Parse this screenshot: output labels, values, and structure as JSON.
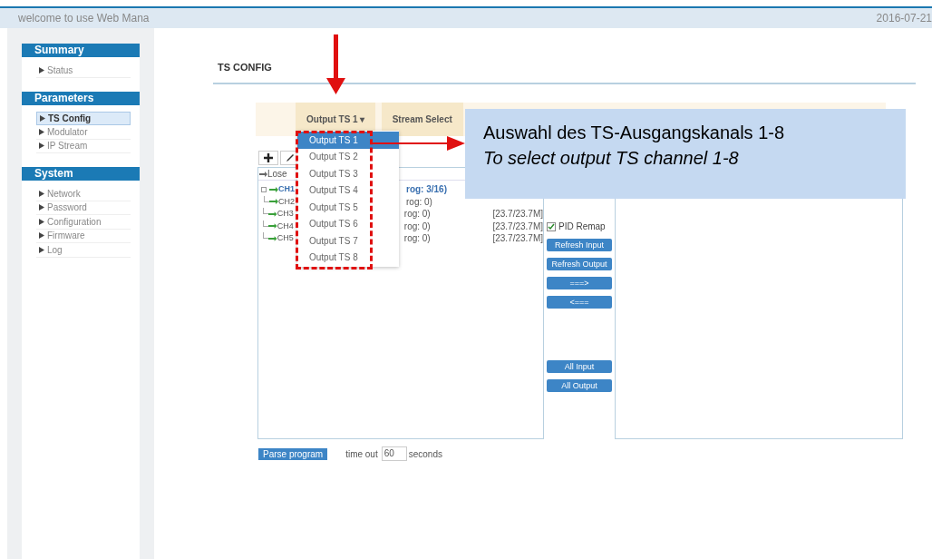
{
  "header": {
    "title": "welcome to use Web Mana",
    "date": "2016-07-21"
  },
  "sidebar": [
    {
      "title": "Summary",
      "items": [
        {
          "label": "Status",
          "selected": false
        }
      ]
    },
    {
      "title": "Parameters",
      "items": [
        {
          "label": "TS Config",
          "selected": true
        },
        {
          "label": "Modulator",
          "selected": false
        },
        {
          "label": "IP Stream",
          "selected": false
        }
      ]
    },
    {
      "title": "System",
      "items": [
        {
          "label": "Network",
          "selected": false
        },
        {
          "label": "Password",
          "selected": false
        },
        {
          "label": "Configuration",
          "selected": false
        },
        {
          "label": "Firmware",
          "selected": false
        },
        {
          "label": "Log",
          "selected": false
        }
      ]
    }
  ],
  "page_title": "TS CONFIG",
  "tabs": [
    {
      "label": "Output TS 1",
      "caret": "▾"
    },
    {
      "label": "Stream Select"
    }
  ],
  "tree": {
    "root": "Lose",
    "channels": [
      {
        "name": "CH1",
        "info": "rog: 3/16)",
        "has_children": true
      },
      {
        "name": "CH2",
        "info": "rog: 0)",
        "has_children": false
      },
      {
        "name": "CH3",
        "info": "rog: 0)",
        "rate": "[23.7/23.7M]",
        "has_children": false
      },
      {
        "name": "CH4",
        "info": "rog: 0)",
        "rate": "[23.7/23.7M]",
        "has_children": false
      },
      {
        "name": "CH5",
        "info": "rog: 0)",
        "rate": "[23.7/23.7M]",
        "has_children": false
      }
    ]
  },
  "checkboxes": [
    {
      "label": "PID Remap",
      "checked": true
    }
  ],
  "buttons": [
    {
      "label": "Refresh Input",
      "kind": "transfer"
    },
    {
      "label": "Refresh Output",
      "kind": "transfer"
    },
    {
      "label": "===>",
      "kind": "transfer"
    },
    {
      "label": "<===",
      "kind": "transfer"
    },
    {
      "label": "All Input",
      "kind": "bulk"
    },
    {
      "label": "All Output",
      "kind": "bulk"
    }
  ],
  "parse": {
    "button": "Parse program",
    "label": "time out",
    "value": "60",
    "unit": "seconds"
  },
  "dropdown": [
    {
      "label": "Output TS 1",
      "selected": true
    },
    {
      "label": "Output TS 2",
      "selected": false
    },
    {
      "label": "Output TS 3",
      "selected": false
    },
    {
      "label": "Output TS 4",
      "selected": false
    },
    {
      "label": "Output TS 5",
      "selected": false
    },
    {
      "label": "Output TS 6",
      "selected": false
    },
    {
      "label": "Output TS 7",
      "selected": false
    },
    {
      "label": "Output TS 8",
      "selected": false
    }
  ],
  "callout": [
    {
      "text": "Auswahl des TS-Ausgangskanals 1-8",
      "italic": false
    },
    {
      "text": "To select output TS channel 1-8",
      "italic": true
    }
  ]
}
